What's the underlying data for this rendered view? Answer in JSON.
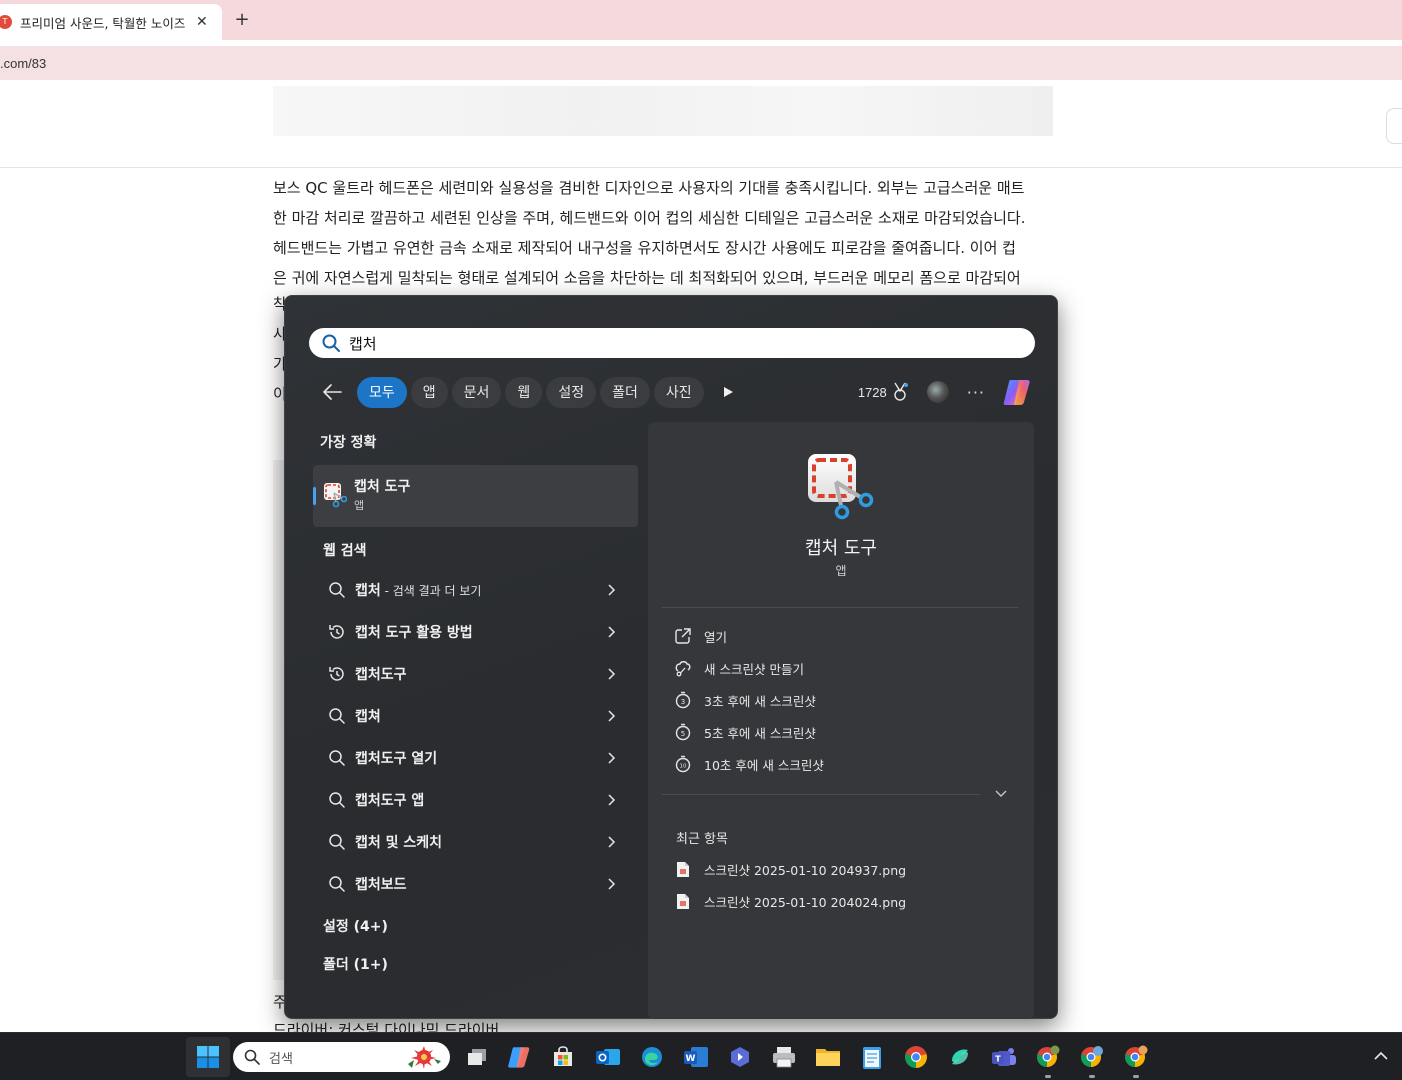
{
  "browser": {
    "tab_title": "프리미엄 사운드, 탁월한 노이즈",
    "tab_favicon_text": "T",
    "tab_close": "✕",
    "new_tab": "+",
    "url": ".com/83"
  },
  "article": {
    "lines": [
      "보스 QC 울트라 헤드폰은 세련미와 실용성을 겸비한 디자인으로 사용자의 기대를 충족시킵니다. 외부는 고급스러운 매트",
      "한 마감 처리로 깔끔하고 세련된 인상을 주며, 헤드밴드와 이어 컵의 세심한 디테일은 고급스러운 소재로 마감되었습니다.",
      "헤드밴드는 가볍고 유연한 금속 소재로 제작되어 내구성을 유지하면서도 장시간 사용에도 피로감을 줄여줍니다. 이어 컵",
      "은 귀에 자연스럽게 밀착되는 형태로 설계되어 소음을 차단하는 데 최적화되어 있으며, 부드러운 메모리 폼으로 마감되어"
    ],
    "partial_line_starts": [
      "착",
      "사",
      "가",
      "이"
    ],
    "footer_partial": "주",
    "footer_line": "드라이버: 커스텀 다이나믹 드라이버"
  },
  "search": {
    "query": "캡처",
    "filters": [
      "모두",
      "앱",
      "문서",
      "웹",
      "설정",
      "폴더",
      "사진"
    ],
    "active_filter": "모두",
    "points": "1728",
    "more": "···",
    "best_match_heading": "가장 정확",
    "best_match": {
      "title": "캡처 도구",
      "type": "앱"
    },
    "web_heading": "웹 검색",
    "web_results": [
      {
        "icon": "search-icon",
        "text": "캡처",
        "sub": " - 검색 결과 더 보기"
      },
      {
        "icon": "history-icon",
        "text": "캡처 도구 활용 방법",
        "sub": ""
      },
      {
        "icon": "history-icon",
        "text": "캡처도구",
        "sub": ""
      },
      {
        "icon": "search-icon",
        "text": "캡쳐",
        "sub": ""
      },
      {
        "icon": "search-icon",
        "text": "캡처도구 열기",
        "sub": ""
      },
      {
        "icon": "search-icon",
        "text": "캡처도구 앱",
        "sub": ""
      },
      {
        "icon": "search-icon",
        "text": "캡처 및 스케치",
        "sub": ""
      },
      {
        "icon": "search-icon",
        "text": "캡처보드",
        "sub": ""
      }
    ],
    "settings_heading": "설정 (4+)",
    "folders_heading": "폴더 (1+)",
    "detail": {
      "name": "캡처 도구",
      "type": "앱",
      "actions": [
        {
          "icon": "open-external-icon",
          "label": "열기"
        },
        {
          "icon": "snip-icon",
          "label": "새 스크린샷 만들기"
        },
        {
          "icon": "timer-3-icon",
          "label": "3초 후에 새 스크린샷"
        },
        {
          "icon": "timer-5-icon",
          "label": "5초 후에 새 스크린샷"
        },
        {
          "icon": "timer-10-icon",
          "label": "10초 후에 새 스크린샷"
        }
      ],
      "recent_heading": "최근 항목",
      "recent": [
        "스크린샷 2025-01-10 204937.png",
        "스크린샷 2025-01-10 204024.png"
      ]
    }
  },
  "taskbar": {
    "search_placeholder": "검색",
    "apps": [
      "task-view-icon",
      "copilot-icon",
      "store-icon",
      "outlook-icon",
      "edge-icon",
      "word-icon",
      "bing-icon",
      "snipping-tool-icon",
      "file-explorer-icon",
      "notepad-icon",
      "chrome-icon",
      "copilot-app-icon",
      "teams-icon",
      "chrome-profile-1-icon",
      "chrome-profile-2-icon",
      "chrome-profile-3-icon"
    ]
  },
  "colors": {
    "accent": "#1c75c6",
    "panel_bg": "#2b2d30",
    "tabbar_bg": "#f5d9dc",
    "taskbar_bg": "#1f2023"
  }
}
